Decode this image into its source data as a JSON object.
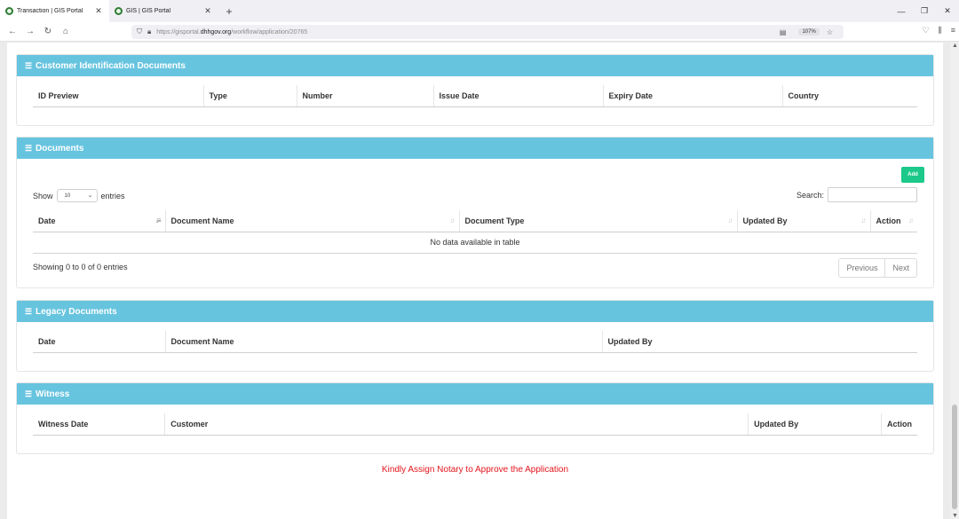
{
  "browser": {
    "tabs": [
      {
        "title": "Transaction | GIS Portal",
        "active": true
      },
      {
        "title": "GIS | GIS Portal",
        "active": false
      }
    ],
    "new_tab_icon": "plus-icon",
    "url_prefix": "https://gisportal.",
    "url_domain": "dhhgov.org",
    "url_path": "/workflow/application/20765",
    "zoom": "107%"
  },
  "sections": {
    "customer_ids": {
      "title": "Customer Identification Documents",
      "columns": [
        "ID Preview",
        "Type",
        "Number",
        "Issue Date",
        "Expiry Date",
        "Country"
      ]
    },
    "documents": {
      "title": "Documents",
      "add_label": "Add",
      "show_label": "Show",
      "page_length": "10",
      "entries_label": "entries",
      "search_label": "Search:",
      "columns": [
        "Date",
        "Document Name",
        "Document Type",
        "Updated By",
        "Action"
      ],
      "empty_text": "No data available in table",
      "info": "Showing 0 to 0 of 0 entries",
      "prev_label": "Previous",
      "next_label": "Next"
    },
    "legacy": {
      "title": "Legacy Documents",
      "columns": [
        "Date",
        "Document Name",
        "Updated By"
      ]
    },
    "witness": {
      "title": "Witness",
      "columns": [
        "Witness Date",
        "Customer",
        "Updated By",
        "Action"
      ]
    }
  },
  "notice": "Kindly Assign Notary to Approve the Application",
  "colors": {
    "panel_header": "#67c4df",
    "add_button": "#1cc88a",
    "notice_text": "#e3161c"
  }
}
